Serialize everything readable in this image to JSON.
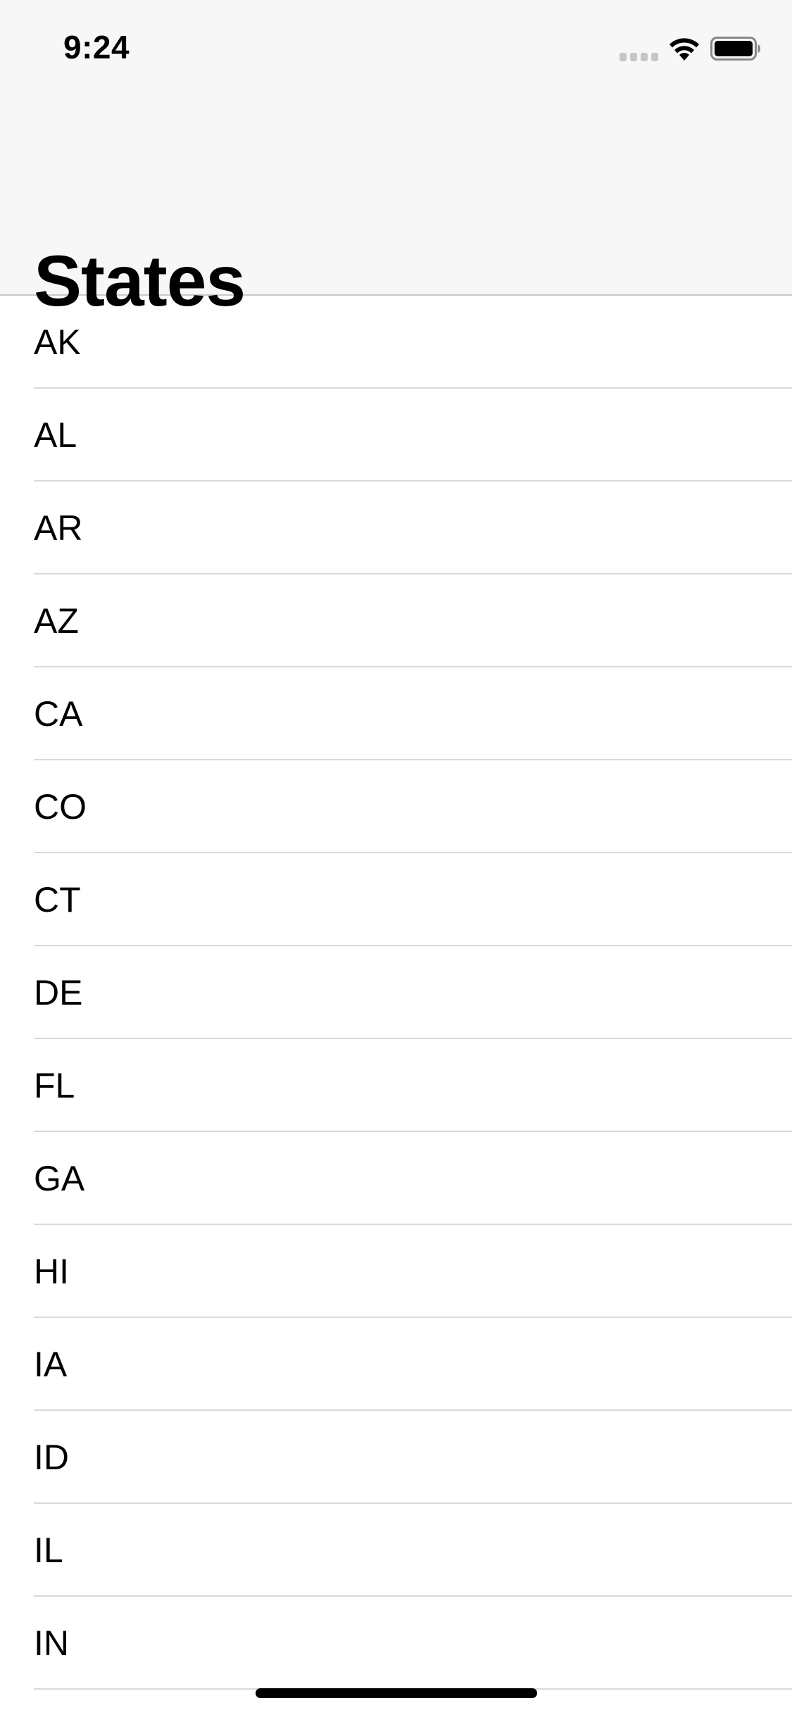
{
  "status_bar": {
    "time": "9:24",
    "icons": [
      "cellular-signal-icon",
      "wifi-icon",
      "battery-icon"
    ]
  },
  "nav": {
    "title": "States"
  },
  "list": {
    "items": [
      "AK",
      "AL",
      "AR",
      "AZ",
      "CA",
      "CO",
      "CT",
      "DE",
      "FL",
      "GA",
      "HI",
      "IA",
      "ID",
      "IL",
      "IN"
    ]
  },
  "colors": {
    "nav_background": "#f7f7f7",
    "separator": "#d9d9dc",
    "text": "#000000",
    "background": "#ffffff"
  }
}
